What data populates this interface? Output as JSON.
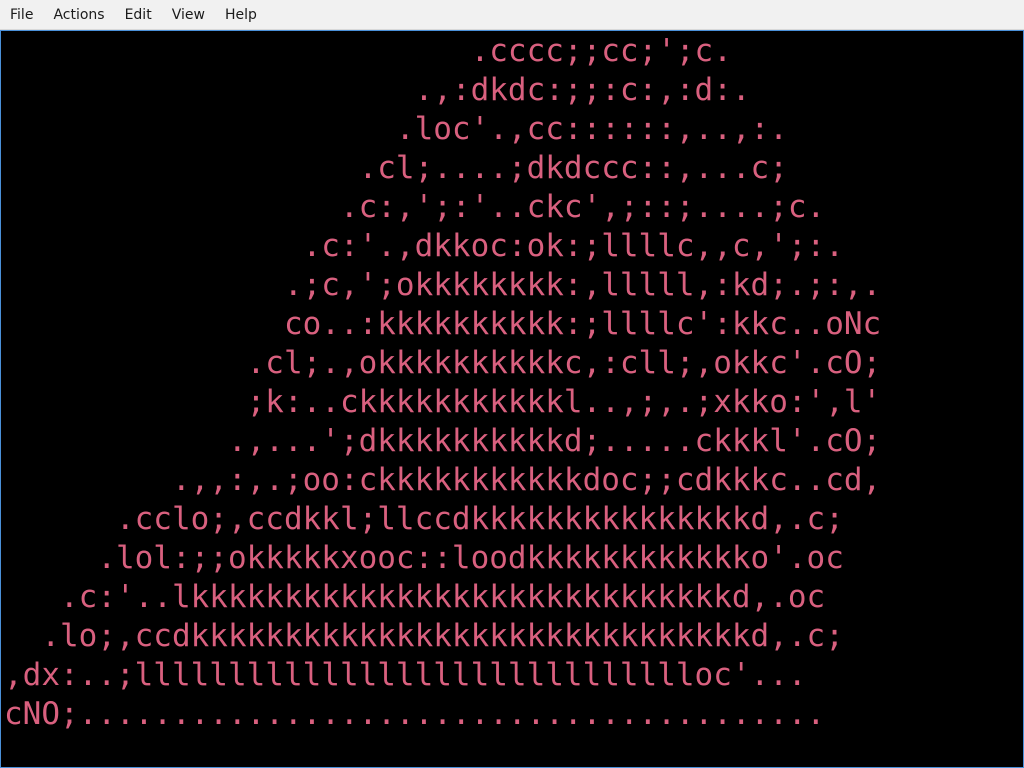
{
  "menubar": {
    "items": [
      {
        "label": "File"
      },
      {
        "label": "Actions"
      },
      {
        "label": "Edit"
      },
      {
        "label": "View"
      },
      {
        "label": "Help"
      }
    ]
  },
  "terminal": {
    "text_color": "#d9607f",
    "background": "#000000",
    "lines": [
      "                         .cccc;;cc;';c.",
      "                      .,:dkdc:;;:c:,:d:.",
      "                     .loc'.,cc::::::,..,:.",
      "                   .cl;....;dkdccc::,...c;",
      "                  .c:,';:'..ckc',;::;....;c.",
      "                .c:'.,dkkoc:ok:;llllc,,c,';:.",
      "               .;c,';okkkkkkkk:,lllll,:kd;.;:,.",
      "               co..:kkkkkkkkkk:;llllc':kkc..oNc",
      "             .cl;.,okkkkkkkkkkc,:cll;,okkc'.cO;",
      "             ;k:..ckkkkkkkkkkkl..,;,.;xkko:',l'",
      "            .,...';dkkkkkkkkkkd;.....ckkkl'.cO;",
      "         .,,:,.;oo:ckkkkkkkkkkkdoc;;cdkkkc..cd,",
      "      .cclo;,ccdkkl;llccdkkkkkkkkkkkkkkkd,.c;",
      "     .lol:;;okkkkkxooc::loodkkkkkkkkkkkko'.oc",
      "   .c:'..lkkkkkkkkkkkkkkkkkkkkkkkkkkkkkd,.oc",
      "  .lo;,ccdkkkkkkkkkkkkkkkkkkkkkkkkkkkkkkd,.c;",
      ",dx:..;lllllllllllllllllllllllllllllloc'...",
      "cNO;........................................"
    ]
  }
}
